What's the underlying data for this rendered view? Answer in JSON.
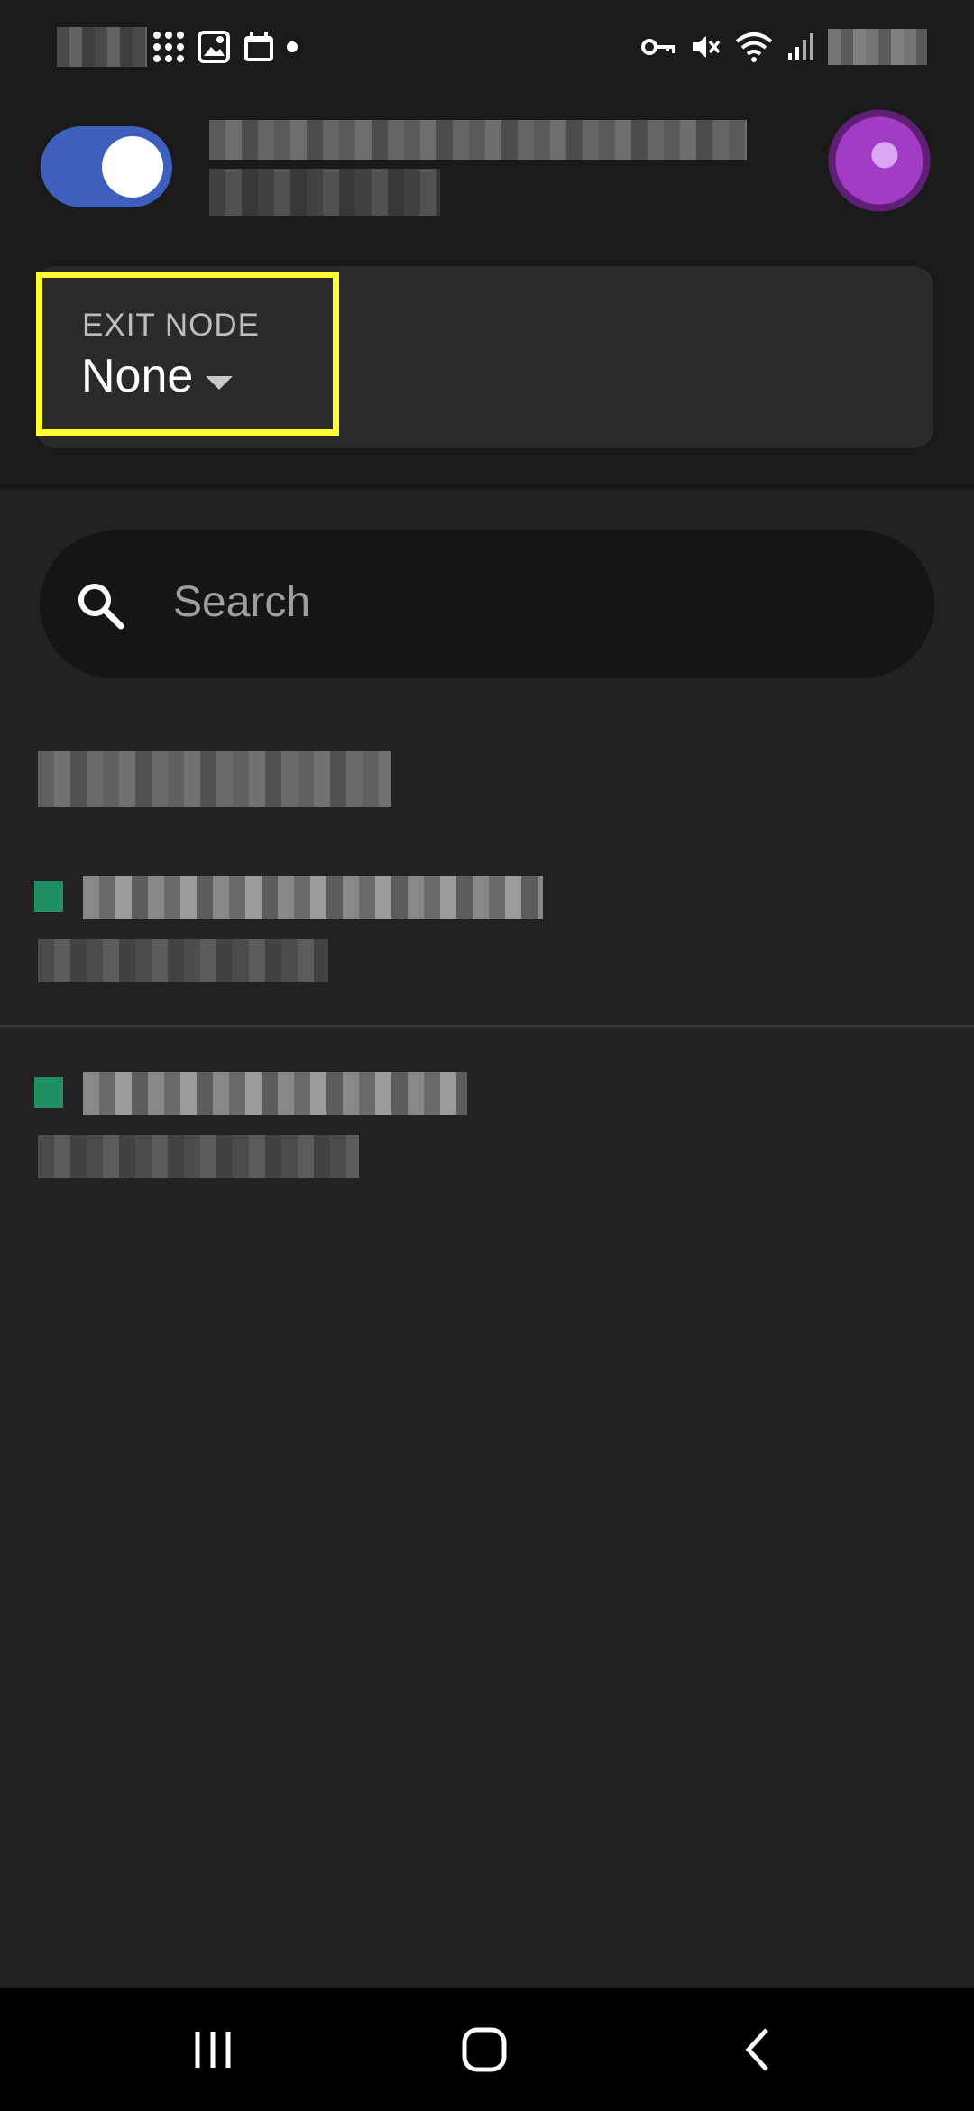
{
  "status_bar": {
    "left_icons": [
      "grid-dots-icon",
      "gallery-icon",
      "calendar-icon",
      "notification-dot-icon"
    ],
    "right_icons": [
      "vpn-key-icon",
      "mute-icon",
      "wifi-icon",
      "signal-icon"
    ]
  },
  "header": {
    "vpn_toggle": "on",
    "account_name": "",
    "account_status": ""
  },
  "exit_node": {
    "label": "EXIT NODE",
    "value": "None"
  },
  "search": {
    "placeholder": "Search"
  },
  "section_title": "",
  "devices": [
    {
      "name": "",
      "ip": "",
      "status": "online"
    },
    {
      "name": "",
      "ip": "",
      "status": "online"
    }
  ],
  "nav": {
    "recents": "recents-icon",
    "home": "home-icon",
    "back": "back-icon"
  },
  "colors": {
    "toggle_on": "#3f5fbe",
    "highlight": "#ffff33",
    "online": "#1d8f63",
    "avatar": "#a23cc6"
  }
}
